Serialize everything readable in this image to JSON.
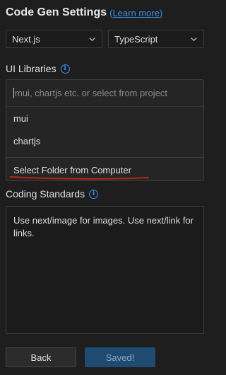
{
  "header": {
    "title": "Code Gen Settings",
    "learn_more": "(Learn more)"
  },
  "framework_select": {
    "value": "Next.js",
    "icon": "chevron-down-icon"
  },
  "language_select": {
    "value": "TypeScript",
    "icon": "chevron-down-icon"
  },
  "ui_libraries": {
    "label": "UI Libraries",
    "info_icon": "info-icon",
    "input_placeholder": "mui, chartjs etc. or select from project",
    "options": [
      "mui",
      "chartjs"
    ],
    "select_folder_label": "Select Folder from Computer",
    "annotation_color": "#b5271a"
  },
  "coding_standards": {
    "label": "Coding Standards",
    "info_icon": "info-icon",
    "value": "Use next/image for images. Use next/link for links."
  },
  "footer": {
    "back_label": "Back",
    "saved_label": "Saved!"
  },
  "colors": {
    "background": "#1e1e1e",
    "link": "#3b8eea",
    "primary_button": "#1f4a72"
  }
}
